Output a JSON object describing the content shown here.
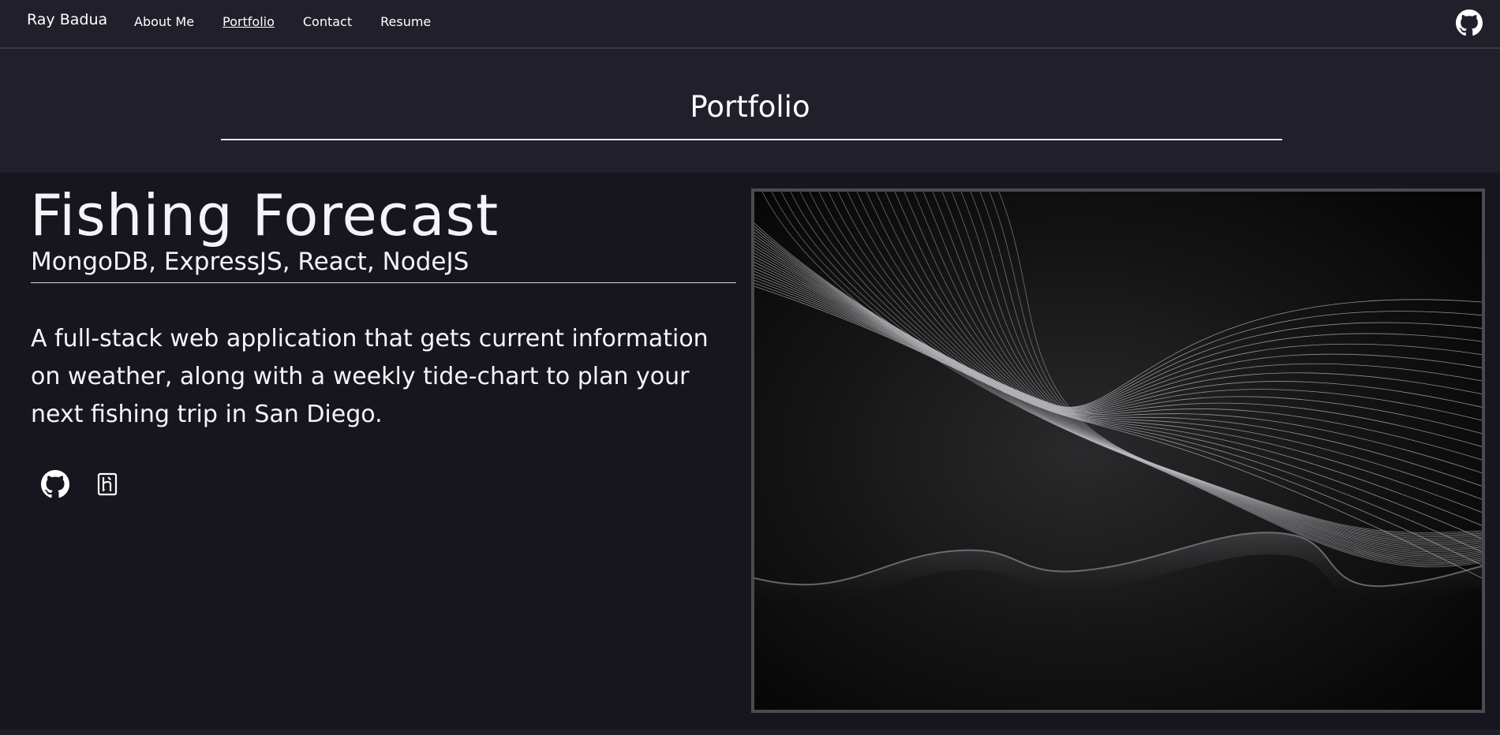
{
  "nav": {
    "brand": "Ray Badua",
    "links": [
      {
        "label": "About Me",
        "active": false
      },
      {
        "label": "Portfolio",
        "active": true
      },
      {
        "label": "Contact",
        "active": false
      },
      {
        "label": "Resume",
        "active": false
      }
    ],
    "github_icon": "github-icon"
  },
  "header": {
    "title": "Portfolio"
  },
  "project": {
    "title": "Fishing Forecast",
    "stack": "MongoDB, ExpressJS, React, NodeJS",
    "description": "A full-stack web application that gets current information on weather, along with a weekly tide-chart to plan your next fishing trip in San Diego.",
    "links": [
      {
        "icon": "github-icon"
      },
      {
        "icon": "heroku-icon"
      }
    ]
  },
  "colors": {
    "nav_bg": "#201f2a",
    "section_bg": "#17161e",
    "text": "#f4f4f8",
    "image_border": "#4a4a52"
  }
}
